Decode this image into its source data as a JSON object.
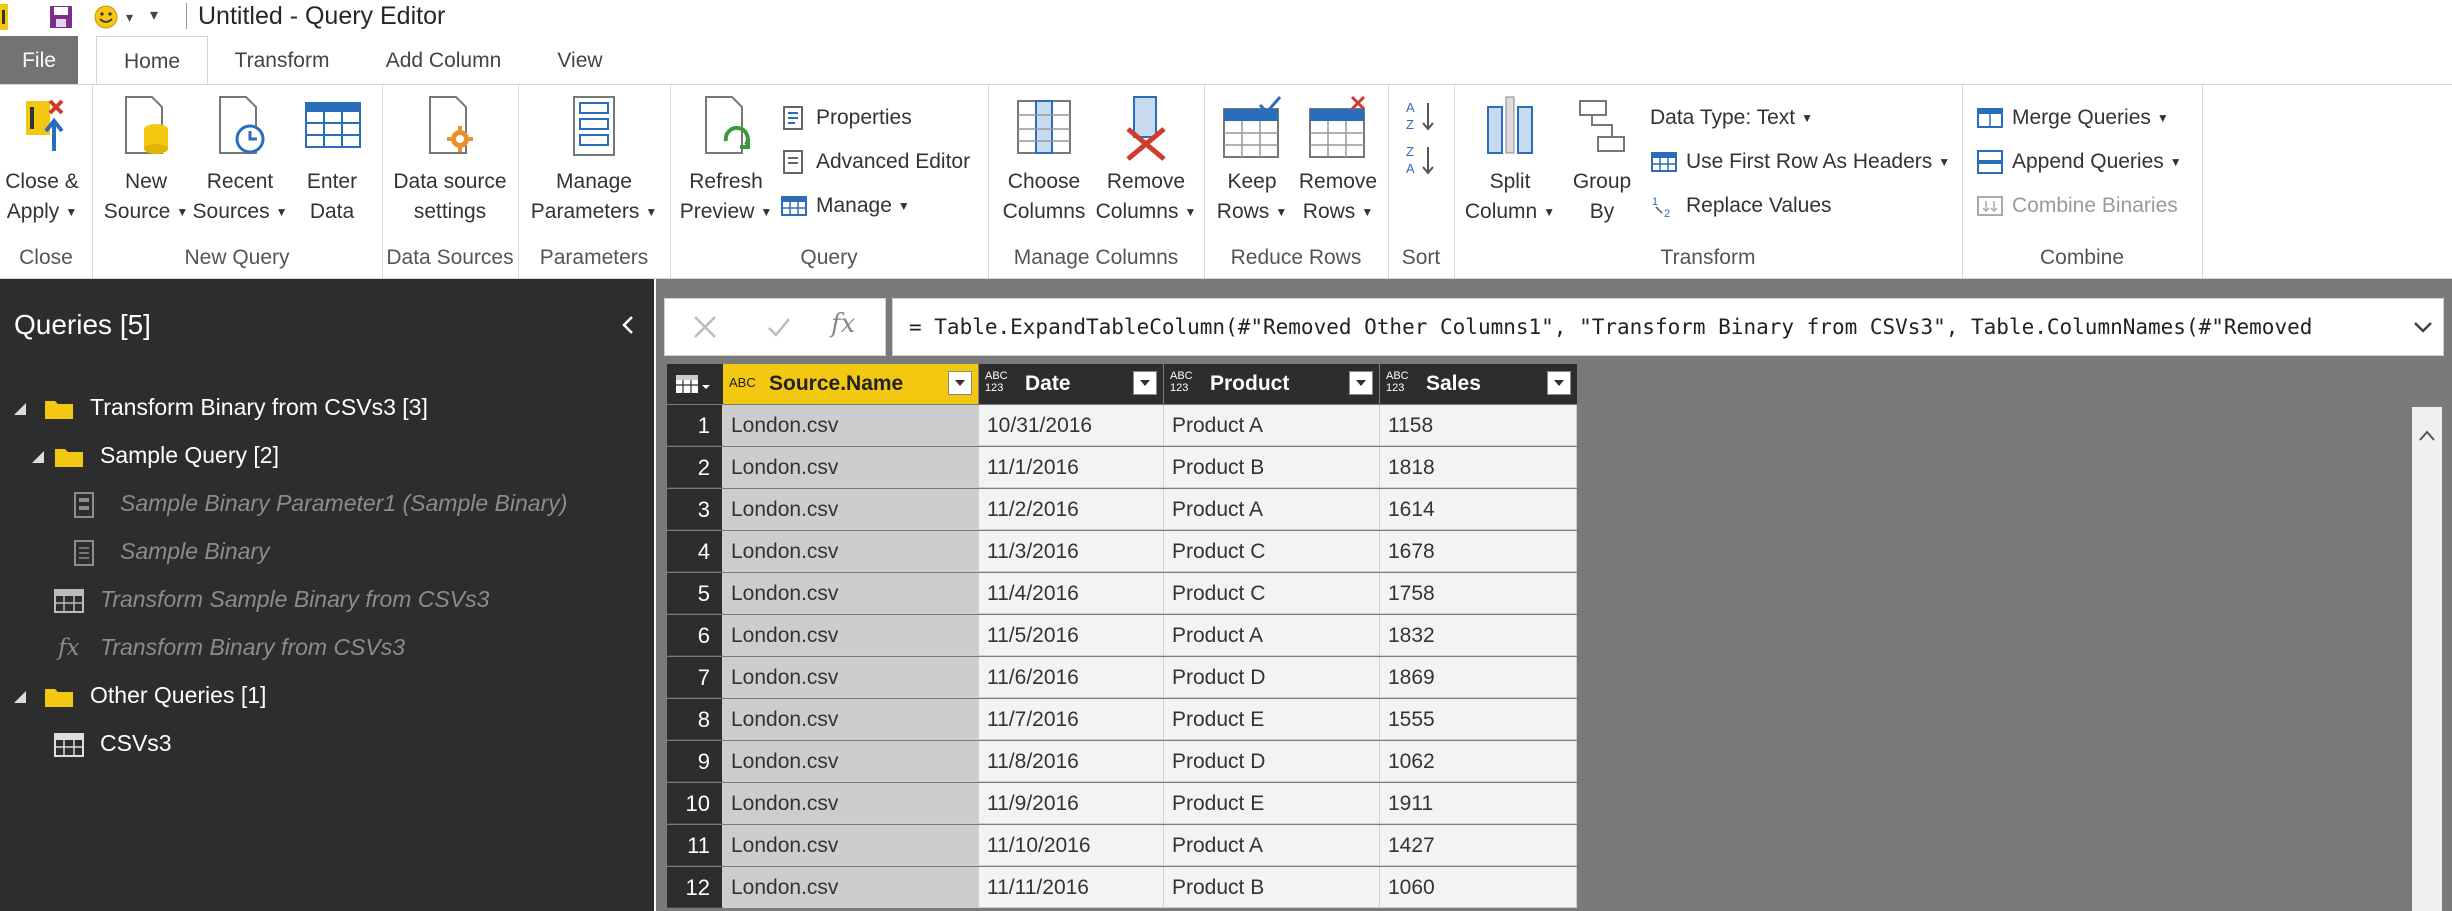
{
  "window": {
    "title": "Untitled - Query Editor"
  },
  "tabs": [
    "File",
    "Home",
    "Transform",
    "Add Column",
    "View"
  ],
  "ribbon": {
    "groups": {
      "close": {
        "label": "Close",
        "close_apply": [
          "Close &",
          "Apply"
        ]
      },
      "new_query": {
        "label": "New Query",
        "new_source": [
          "New",
          "Source"
        ],
        "recent_sources": [
          "Recent",
          "Sources"
        ],
        "enter_data": [
          "Enter",
          "Data"
        ]
      },
      "data_sources": {
        "label": "Data Sources",
        "ds_settings": [
          "Data source",
          "settings"
        ]
      },
      "parameters": {
        "label": "Parameters",
        "manage_params": [
          "Manage",
          "Parameters"
        ]
      },
      "query": {
        "label": "Query",
        "refresh": [
          "Refresh",
          "Preview"
        ],
        "properties": "Properties",
        "advanced_editor": "Advanced Editor",
        "manage": "Manage"
      },
      "manage_columns": {
        "label": "Manage Columns",
        "choose": [
          "Choose",
          "Columns"
        ],
        "remove": [
          "Remove",
          "Columns"
        ]
      },
      "reduce_rows": {
        "label": "Reduce Rows",
        "keep": [
          "Keep",
          "Rows"
        ],
        "remove": [
          "Remove",
          "Rows"
        ]
      },
      "sort": {
        "label": "Sort"
      },
      "transform": {
        "label": "Transform",
        "split": [
          "Split",
          "Column"
        ],
        "group": [
          "Group",
          "By"
        ],
        "data_type": "Data Type: Text",
        "first_row": "Use First Row As Headers",
        "replace": "Replace Values"
      },
      "combine": {
        "label": "Combine",
        "merge": "Merge Queries",
        "append": "Append Queries",
        "combine_binaries": "Combine Binaries"
      }
    }
  },
  "queries_pane": {
    "title": "Queries [5]",
    "items": [
      {
        "label": "Transform Binary from CSVs3 [3]"
      },
      {
        "label": "Sample Query [2]"
      },
      {
        "label": "Sample Binary Parameter1 (Sample Binary)"
      },
      {
        "label": "Sample Binary"
      },
      {
        "label": "Transform Sample Binary from CSVs3"
      },
      {
        "label": "Transform Binary from CSVs3"
      },
      {
        "label": "Other Queries [1]"
      },
      {
        "label": "CSVs3"
      }
    ]
  },
  "formula": {
    "fx": "fx",
    "text": "= Table.ExpandTableColumn(#\"Removed Other Columns1\", \"Transform Binary from CSVs3\", Table.ColumnNames(#\"Removed"
  },
  "grid": {
    "columns": [
      {
        "name": "Source.Name",
        "type": "ABC"
      },
      {
        "name": "Date",
        "type": "ABC 123"
      },
      {
        "name": "Product",
        "type": "ABC 123"
      },
      {
        "name": "Sales",
        "type": "ABC 123"
      }
    ],
    "rows": [
      [
        "1",
        "London.csv",
        "10/31/2016",
        "Product A",
        "1158"
      ],
      [
        "2",
        "London.csv",
        "11/1/2016",
        "Product B",
        "1818"
      ],
      [
        "3",
        "London.csv",
        "11/2/2016",
        "Product A",
        "1614"
      ],
      [
        "4",
        "London.csv",
        "11/3/2016",
        "Product C",
        "1678"
      ],
      [
        "5",
        "London.csv",
        "11/4/2016",
        "Product C",
        "1758"
      ],
      [
        "6",
        "London.csv",
        "11/5/2016",
        "Product A",
        "1832"
      ],
      [
        "7",
        "London.csv",
        "11/6/2016",
        "Product D",
        "1869"
      ],
      [
        "8",
        "London.csv",
        "11/7/2016",
        "Product E",
        "1555"
      ],
      [
        "9",
        "London.csv",
        "11/8/2016",
        "Product D",
        "1062"
      ],
      [
        "10",
        "London.csv",
        "11/9/2016",
        "Product E",
        "1911"
      ],
      [
        "11",
        "London.csv",
        "11/10/2016",
        "Product A",
        "1427"
      ],
      [
        "12",
        "London.csv",
        "11/11/2016",
        "Product B",
        "1060"
      ]
    ]
  },
  "colors": {
    "accent": "#f2c811",
    "pane": "#2d2d2d",
    "workspace": "#7a7a7a"
  }
}
